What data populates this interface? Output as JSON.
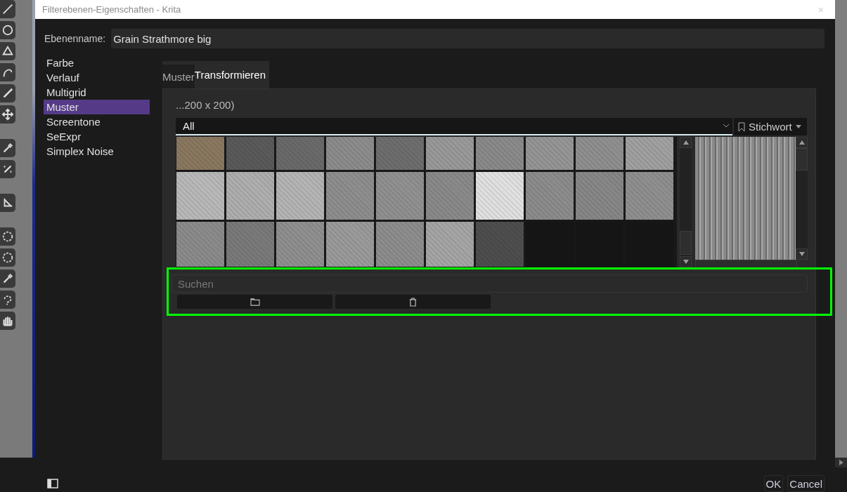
{
  "window": {
    "title": "Filterebenen-Eigenschaften - Krita",
    "close": "×"
  },
  "layer_name": {
    "label": "Ebenenname:",
    "value": "Grain Strathmore big"
  },
  "generators": [
    {
      "label": "Farbe",
      "selected": false
    },
    {
      "label": "Verlauf",
      "selected": false
    },
    {
      "label": "Multigrid",
      "selected": false
    },
    {
      "label": "Muster",
      "selected": true
    },
    {
      "label": "Screentone",
      "selected": false
    },
    {
      "label": "SeExpr",
      "selected": false
    },
    {
      "label": "Simplex Noise",
      "selected": false
    }
  ],
  "tabs": [
    {
      "label": "Muster",
      "selected": false
    },
    {
      "label": "Transformieren",
      "selected": true
    }
  ],
  "pattern_panel": {
    "caption": "...200 x 200)",
    "tag_filter": "All",
    "tag_button": "Stichwort",
    "search": {
      "placeholder": "Suchen"
    }
  },
  "buttons": [
    "OK",
    "Cancel"
  ]
}
